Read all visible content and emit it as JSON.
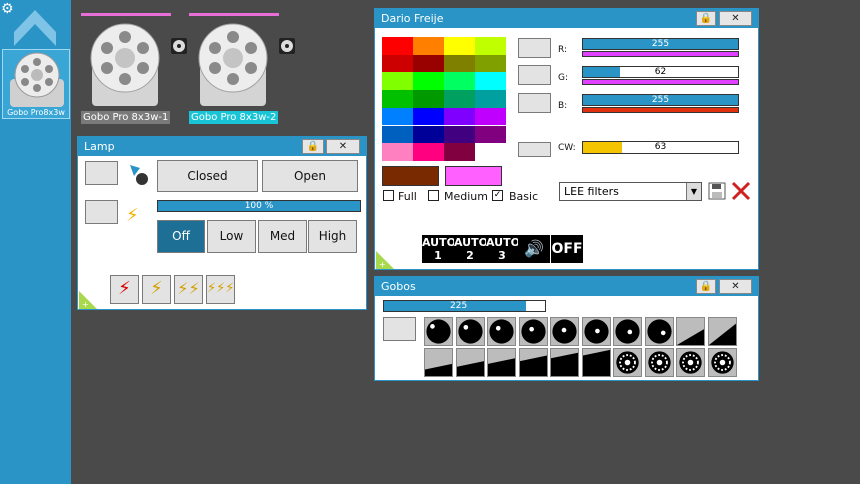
{
  "sidebar": {
    "fixture_label": "Gobo Pro8x3w"
  },
  "fixtures": [
    {
      "name": "Gobo Pro 8x3w-1"
    },
    {
      "name": "Gobo Pro 8x3w-2"
    }
  ],
  "lamp": {
    "title": "Lamp",
    "closed_label": "Closed",
    "open_label": "Open",
    "intensity_text": "100 %",
    "intensity": 100,
    "off_label": "Off",
    "low_label": "Low",
    "med_label": "Med",
    "high_label": "High"
  },
  "color_panel": {
    "title": "Dario Freije",
    "r_label": "R:",
    "g_label": "G:",
    "b_label": "B:",
    "cw_label": "CW:",
    "r_value": "255",
    "g_value": "62",
    "b_value": "255",
    "cw_value": "63",
    "full_label": "Full",
    "medium_label": "Medium",
    "basic_label": "Basic",
    "filter_value": "LEE filters",
    "auto1_label": "AUTO",
    "auto1_num": "1",
    "auto2_label": "AUTO",
    "auto2_num": "2",
    "auto3_label": "AUTO",
    "auto3_num": "3",
    "off_label": "OFF",
    "colors": [
      "#ff0000",
      "#ff8000",
      "#ffff00",
      "#c0ff00",
      "#cc0000",
      "#990000",
      "#808000",
      "#80a000",
      "#80ff00",
      "#00ff00",
      "#00ff60",
      "#00ffff",
      "#00c000",
      "#009900",
      "#00a060",
      "#00a0a0",
      "#0080ff",
      "#0000ff",
      "#8000ff",
      "#c000ff",
      "#0060c0",
      "#000099",
      "#400080",
      "#800080",
      "#ff80c0",
      "#ff0080",
      "#800040",
      "#ffffff"
    ]
  },
  "gobos": {
    "title": "Gobos",
    "value_text": "225",
    "value": 225
  }
}
